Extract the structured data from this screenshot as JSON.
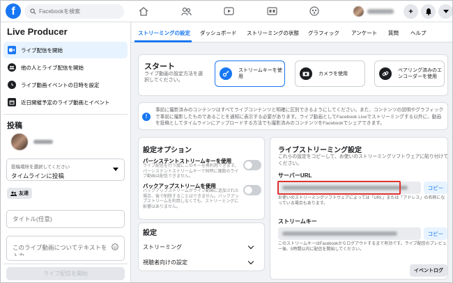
{
  "topbar": {
    "logo": "f",
    "search_placeholder": "Facebookを検索",
    "plus": "+",
    "accent": "#1877f2"
  },
  "sidebar": {
    "title": "Live Producer",
    "items": [
      {
        "label": "ライブ配信を開始",
        "icon": "video-camera-icon",
        "active": true
      },
      {
        "label": "他の人とライブ配信を開始",
        "icon": "group-icon",
        "active": false
      },
      {
        "label": "ライブ動画イベントの日時を設定",
        "icon": "clock-icon",
        "active": false
      },
      {
        "label": "近日開催予定のライブ動画とイベント",
        "icon": "calendar-icon",
        "active": false
      }
    ],
    "post_heading": "投稿",
    "audience_small": "投稿場所を選択してください",
    "audience_value": "タイムラインに投稿",
    "friends_button": "友達",
    "title_placeholder": "タイトル(任意)",
    "desc_placeholder": "このライブ動画についてテキストを入力",
    "go_live_button": "ライブ配信を開始"
  },
  "tabs": [
    "ストリーミングの設定",
    "ダッシュボード",
    "ストリーミングの状態",
    "グラフィック",
    "アンケート",
    "質問",
    "ヘルプ"
  ],
  "start": {
    "heading": "スタート",
    "sub": "ライブ動画の設定方法を選択してください。",
    "options": [
      {
        "label": "ストリームキーを使用",
        "icon": "key-icon",
        "selected": true
      },
      {
        "label": "カメラを使用",
        "icon": "camera-icon",
        "selected": false
      },
      {
        "label": "ペアリング済みのエンコーダーを使用",
        "icon": "link-icon",
        "selected": false
      }
    ]
  },
  "info_text": "事前に撮影済みのコンテンツはすべてライブコンテンツと明確に区別できるようにしてください。また、コンテンツの説明やグラフィックで事前に撮影したものであることを通知に表示する必要があります。ライブ動画としてFacebook Liveでストリーミングする以外に、動画を投稿としてタイムラインにアップロードする方法でも撮影済みのコンテンツをFacebookでシェアできます。",
  "settings_options": {
    "heading": "設定オプション",
    "persistent_label": "パーシステントストリームキーを使用",
    "persistent_desc": "ライブ配信を行う度にこのキーを再利用できます。パーシステントストリームキーで同時に複数のライブ動画は配信できません。",
    "backup_label": "バックアップストリームを使用",
    "backup_desc": "バックアップストリームがライブ動画に追加された場合、後で削除することはできません。バックアップストリームを利用しなくても、ストリーミングに影響はありません。"
  },
  "settings": {
    "heading": "設定",
    "rows": [
      "ストリーミング",
      "視聴者向けの設定"
    ]
  },
  "live_settings": {
    "heading": "ライブストリーミング設定",
    "sub": "これらの設定をコピーして、お使いのストリーミングソフトウェアに貼り付けてください。",
    "server_url_label": "サーバーURL",
    "copy_label": "コピー",
    "server_note": "お使いのストリーミングソフトウェアによっては「URL」または「アドレス」の名称になっている場合もあります。",
    "stream_key_label": "ストリームキー",
    "stream_key_note": "このストリームキーはFacebookからログアウトするまで有効です。ライブ配信のプレビュー後、5時間以内に配信を開始してください。",
    "event_log_button": "イベントログ",
    "highlight_color": "#e0312d"
  }
}
